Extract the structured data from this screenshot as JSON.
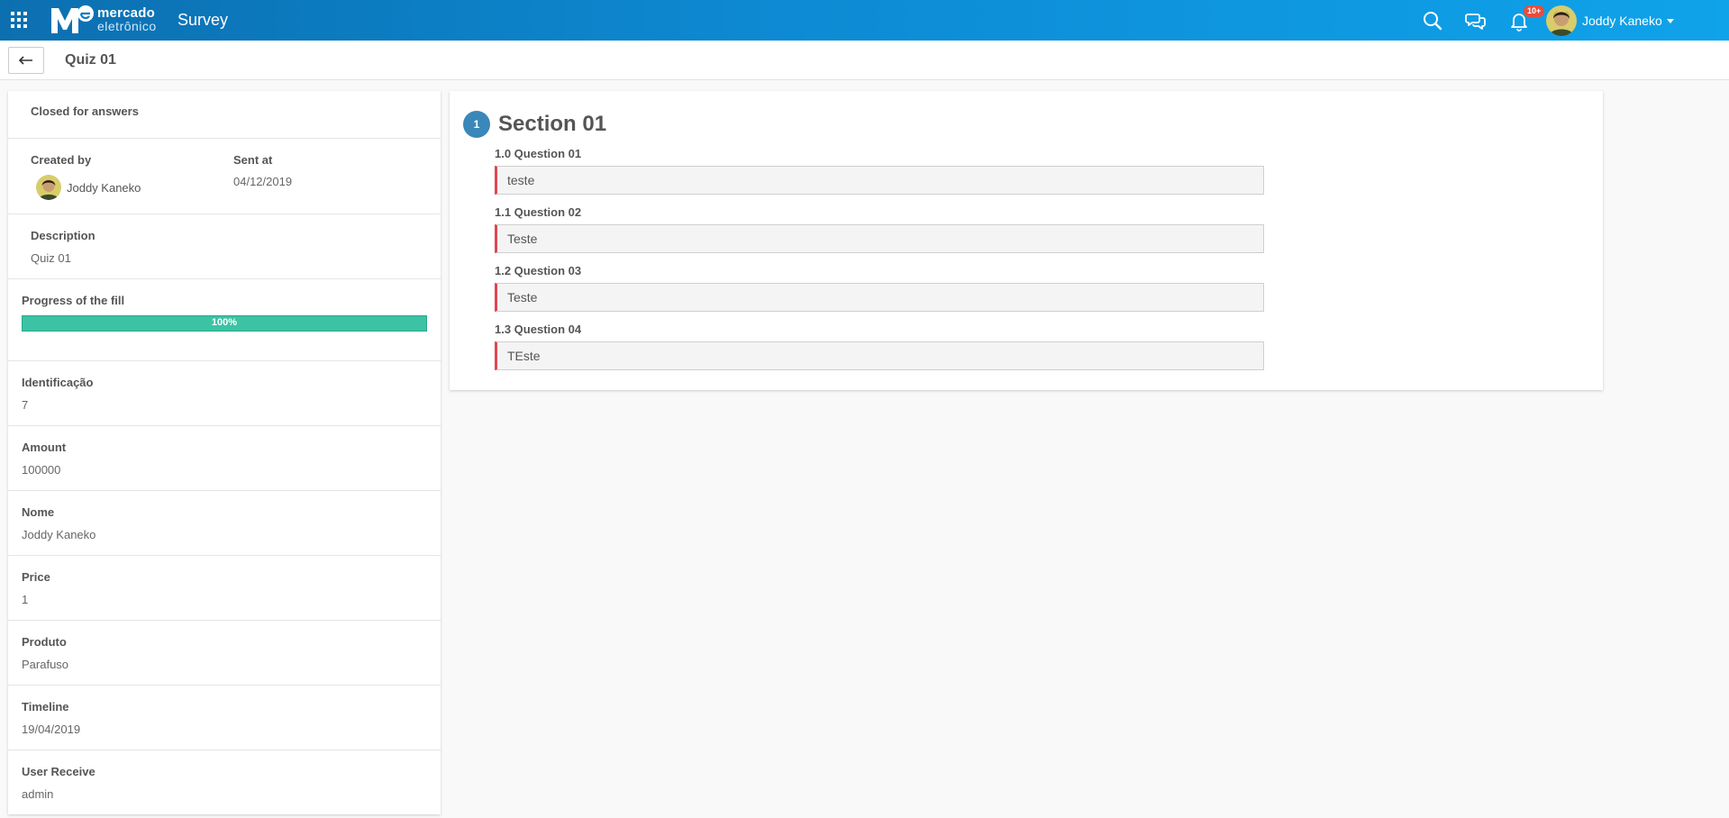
{
  "topbar": {
    "logo_line1": "mercado",
    "logo_line2": "eletrônico",
    "app_title": "Survey",
    "notification_count": "10+",
    "user_name": "Joddy Kaneko",
    "icons": [
      "apps-grid-icon",
      "search-icon",
      "chat-icon",
      "bell-icon",
      "avatar",
      "caret-down-icon"
    ]
  },
  "subheader": {
    "back_icon": "arrow-left-icon",
    "title": "Quiz 01"
  },
  "sidebar": {
    "status": "Closed for answers",
    "created_by_label": "Created by",
    "created_by_value": "Joddy Kaneko",
    "sent_at_label": "Sent at",
    "sent_at_value": "04/12/2019",
    "description_label": "Description",
    "description_value": "Quiz 01",
    "progress_label": "Progress of the fill",
    "progress_value": 1.0,
    "progress_text": "100%",
    "fields": [
      {
        "label": "Identificação",
        "value": "7"
      },
      {
        "label": "Amount",
        "value": "100000"
      },
      {
        "label": "Nome",
        "value": "Joddy Kaneko"
      },
      {
        "label": "Price",
        "value": "1"
      },
      {
        "label": "Produto",
        "value": "Parafuso"
      },
      {
        "label": "Timeline",
        "value": "19/04/2019"
      },
      {
        "label": "User Receive",
        "value": "admin"
      }
    ]
  },
  "survey": {
    "section_number": "1",
    "section_title": "Section 01",
    "questions": [
      {
        "label": "1.0 Question 01",
        "answer": "teste"
      },
      {
        "label": "1.1 Question 02",
        "answer": "Teste"
      },
      {
        "label": "1.2 Question 03",
        "answer": "Teste"
      },
      {
        "label": "1.3 Question 04",
        "answer": "TEste"
      }
    ]
  },
  "colors": {
    "topbar_start": "#0c6fb0",
    "topbar_end": "#0fa3ea",
    "progress": "#3cc3a4",
    "section_badge": "#3a87b9",
    "answer_accent": "#e0454f",
    "badge": "#e74c3c"
  }
}
